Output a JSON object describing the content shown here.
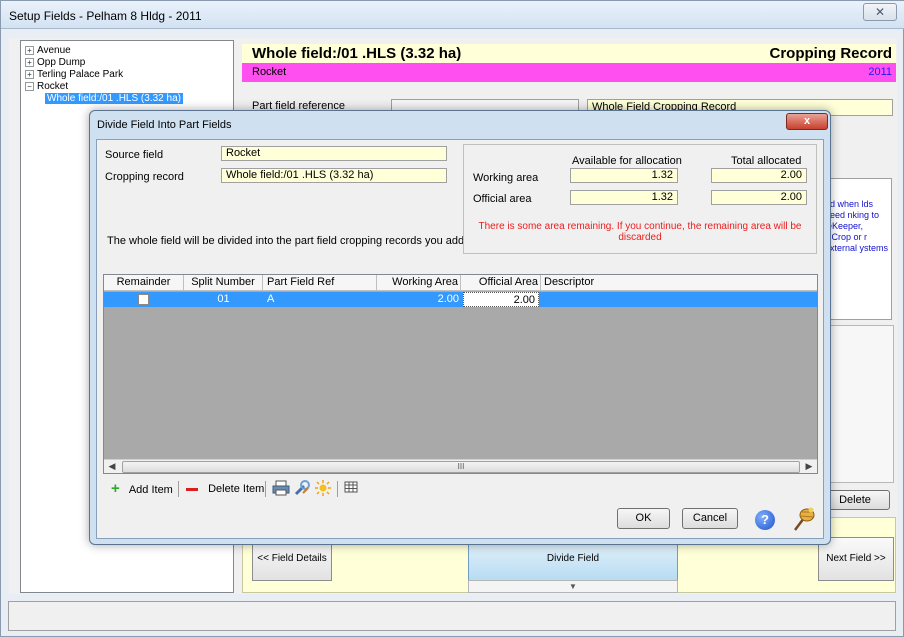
{
  "main_window": {
    "title": "Setup Fields  - Pelham 8 Hldg - 2011",
    "close_label": "✕"
  },
  "tree": {
    "items": [
      {
        "label": "Avenue",
        "expander": "+"
      },
      {
        "label": "Opp Dump",
        "expander": "+"
      },
      {
        "label": "Terling Palace Park",
        "expander": "+"
      },
      {
        "label": "Rocket",
        "expander": "−"
      },
      {
        "label": "Whole field:/01 .HLS (3.32 ha)"
      }
    ]
  },
  "header": {
    "title": "Whole field:/01 .HLS (3.32 ha)",
    "right_title": "Cropping Record",
    "crop": "Rocket",
    "year": "2011"
  },
  "part_field": {
    "label": "Part field reference",
    "value": "",
    "record_label": "Whole Field Cropping Record"
  },
  "info_text": "ed when lds need nking to ieKeeper, itiCrop or r external ystems",
  "delete_label": "Delete",
  "nav": {
    "prev": "<< Field Details",
    "divide": "Divide Field",
    "next": "Next Field >>",
    "divide_arrow": "▼"
  },
  "dialog": {
    "title": "Divide Field Into Part Fields",
    "close_label": "x",
    "source_field_label": "Source field",
    "source_field_value": "Rocket",
    "cropping_record_label": "Cropping record",
    "cropping_record_value": "Whole field:/01 .HLS (3.32 ha)",
    "description": "The whole field will be divided into the part field cropping records you add.",
    "allocation": {
      "available_header": "Available for allocation",
      "total_header": "Total allocated",
      "working_area_label": "Working area",
      "working_available": "1.32",
      "working_total": "2.00",
      "official_area_label": "Official area",
      "official_available": "1.32",
      "official_total": "2.00"
    },
    "warning": "There is some area remaining. If you continue, the remaining area will be discarded",
    "grid": {
      "columns": [
        "Remainder",
        "Split Number",
        "Part Field Ref",
        "Working Area",
        "Official Area",
        "Descriptor"
      ],
      "rows": [
        {
          "remainder": "",
          "split_number": "01",
          "part_field_ref": "A",
          "working_area": "2.00",
          "official_area": "2.00",
          "descriptor": ""
        }
      ],
      "scroll_thumb": "III"
    },
    "toolbar": {
      "add_label": "Add Item",
      "delete_label": "Delete Item"
    },
    "ok_label": "OK",
    "cancel_label": "Cancel",
    "help_label": "?"
  },
  "colors": {
    "header_bg": "#ffffd8",
    "crop_bar": "#ff4ff0",
    "selection": "#3399ff",
    "warning": "#ee1c1c",
    "year": "#1c1cf0"
  }
}
